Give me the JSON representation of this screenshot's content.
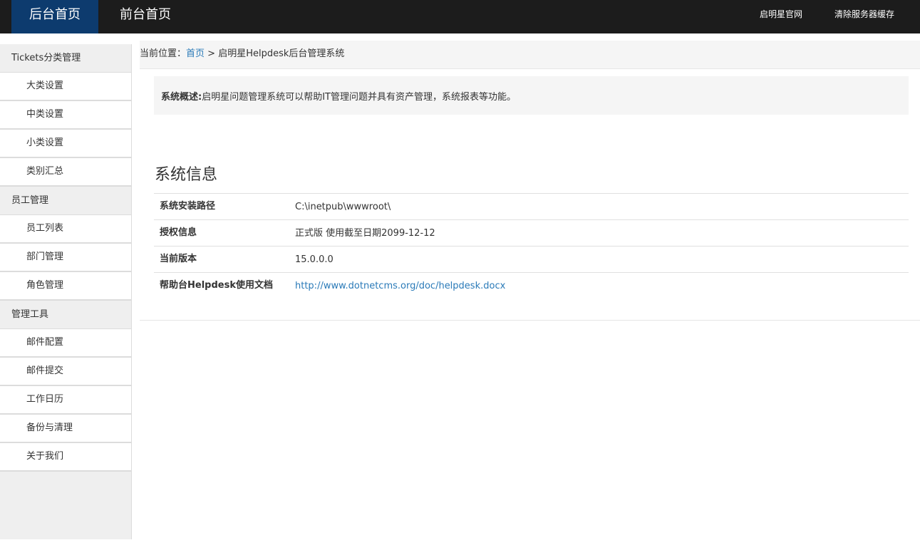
{
  "topbar": {
    "nav": [
      {
        "label": "后台首页",
        "active": true
      },
      {
        "label": "前台首页",
        "active": false
      }
    ],
    "links": {
      "site": "启明星官网",
      "clear_cache": "清除服务器缓存"
    }
  },
  "sidebar": {
    "groups": [
      {
        "title": "Tickets分类管理",
        "items": [
          "大类设置",
          "中类设置",
          "小类设置",
          "类别汇总"
        ]
      },
      {
        "title": "员工管理",
        "items": [
          "员工列表",
          "部门管理",
          "角色管理"
        ]
      },
      {
        "title": "管理工具",
        "items": [
          "邮件配置",
          "邮件提交",
          "工作日历",
          "备份与清理",
          "关于我们"
        ]
      }
    ]
  },
  "breadcrumb": {
    "prefix": "当前位置：",
    "home": "首页",
    "sep": " > ",
    "current": "启明星Helpdesk后台管理系统"
  },
  "overview": {
    "label": "系统概述:",
    "text": "启明星问题管理系统可以帮助IT管理问题并具有资产管理，系统报表等功能。"
  },
  "system_info": {
    "title": "系统信息",
    "rows": [
      {
        "label": "系统安装路径",
        "value": "C:\\inetpub\\wwwroot\\"
      },
      {
        "label": "授权信息",
        "value": "正式版 使用截至日期2099-12-12"
      },
      {
        "label": "当前版本",
        "value": "15.0.0.0"
      },
      {
        "label": "帮助台Helpdesk使用文档",
        "value": "http://www.dotnetcms.org/doc/helpdesk.docx"
      }
    ]
  },
  "colors": {
    "topbar_bg": "#1c1c1c",
    "active_nav_bg": "#0d3b6e",
    "link": "#2a7ab8"
  }
}
